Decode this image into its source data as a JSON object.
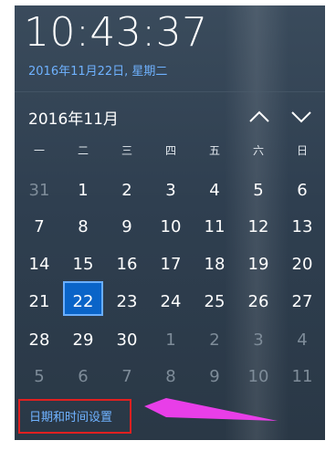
{
  "clock": {
    "time": "10:43:37",
    "date_line": "2016年11月22日, 星期二"
  },
  "calendar": {
    "month_title": "2016年11月",
    "weekdays": [
      "一",
      "二",
      "三",
      "四",
      "五",
      "六",
      "日"
    ],
    "rows": [
      [
        {
          "d": "31",
          "dim": true
        },
        {
          "d": "1"
        },
        {
          "d": "2"
        },
        {
          "d": "3"
        },
        {
          "d": "4"
        },
        {
          "d": "5"
        },
        {
          "d": "6"
        }
      ],
      [
        {
          "d": "7"
        },
        {
          "d": "8"
        },
        {
          "d": "9"
        },
        {
          "d": "10"
        },
        {
          "d": "11"
        },
        {
          "d": "12"
        },
        {
          "d": "13"
        }
      ],
      [
        {
          "d": "14"
        },
        {
          "d": "15"
        },
        {
          "d": "16"
        },
        {
          "d": "17"
        },
        {
          "d": "18"
        },
        {
          "d": "19"
        },
        {
          "d": "20"
        }
      ],
      [
        {
          "d": "21"
        },
        {
          "d": "22",
          "today": true
        },
        {
          "d": "23"
        },
        {
          "d": "24"
        },
        {
          "d": "25"
        },
        {
          "d": "26"
        },
        {
          "d": "27"
        }
      ],
      [
        {
          "d": "28"
        },
        {
          "d": "29"
        },
        {
          "d": "30"
        },
        {
          "d": "1",
          "dim": true
        },
        {
          "d": "2",
          "dim": true
        },
        {
          "d": "3",
          "dim": true
        },
        {
          "d": "4",
          "dim": true
        }
      ],
      [
        {
          "d": "5",
          "dim": true
        },
        {
          "d": "6",
          "dim": true
        },
        {
          "d": "7",
          "dim": true
        },
        {
          "d": "8",
          "dim": true
        },
        {
          "d": "9",
          "dim": true
        },
        {
          "d": "10",
          "dim": true
        },
        {
          "d": "11",
          "dim": true
        }
      ]
    ]
  },
  "footer": {
    "settings_link": "日期和时间设置"
  },
  "colors": {
    "accent": "#0a64c8",
    "link": "#6fb2ff",
    "highlight": "#e02020",
    "arrow": "#e83ee8"
  },
  "icons": {
    "prev": "chevron-up-icon",
    "next": "chevron-down-icon"
  }
}
